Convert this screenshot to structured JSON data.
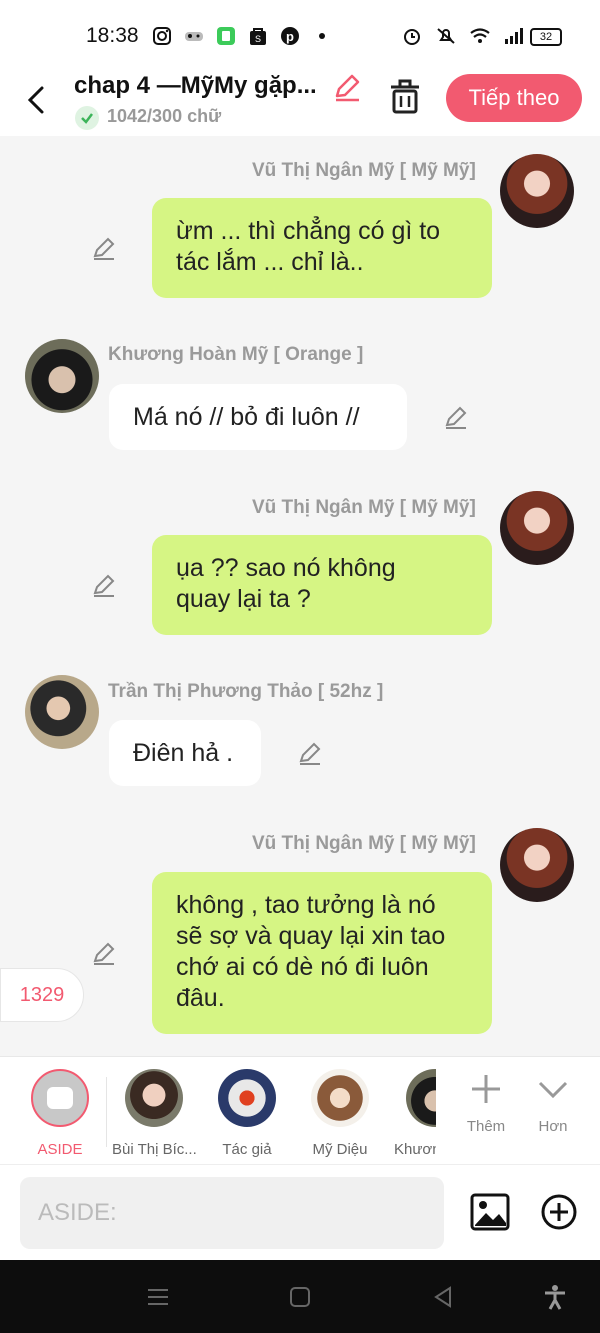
{
  "status": {
    "time": "18:38",
    "battery": "32"
  },
  "header": {
    "title": "chap 4 —MỹMy gặp...",
    "word_count": "1042/300 chữ",
    "next_label": "Tiếp theo"
  },
  "messages": [
    {
      "sender": "Vũ Thị Ngân Mỹ [ Mỹ Mỹ]",
      "lines": [
        "ừm ... thì chẳng có gì to",
        "tác lắm ... chỉ là.."
      ]
    },
    {
      "sender": "Khương Hoàn Mỹ [ Orange ]",
      "lines": [
        "Má nó // bỏ đi luôn //"
      ]
    },
    {
      "sender": "Vũ Thị Ngân Mỹ [ Mỹ Mỹ]",
      "lines": [
        "ụa ?? sao nó không",
        "quay lại ta ?"
      ]
    },
    {
      "sender": "Trần Thị Phương Thảo [ 52hz ]",
      "lines": [
        "Điên hả ."
      ]
    },
    {
      "sender": "Vũ Thị Ngân Mỹ [ Mỹ Mỹ]",
      "lines": [
        "không , tao tưởng là nó",
        "sẽ sợ và quay lại xin tao",
        "chớ ai có dè nó đi luôn",
        "đâu."
      ]
    }
  ],
  "counter_badge": "1329",
  "characters": [
    {
      "label": "ASIDE"
    },
    {
      "label": "Bùi Thị Bíc..."
    },
    {
      "label": "Tác giả"
    },
    {
      "label": "Mỹ Diệu"
    },
    {
      "label": "Khươn"
    }
  ],
  "tools": {
    "add_label": "Thêm",
    "more_label": "Hơn"
  },
  "input": {
    "placeholder": "ASIDE:"
  },
  "colors": {
    "accent": "#f25a70",
    "bubble_right": "#d6f584",
    "bubble_left": "#ffffff"
  }
}
